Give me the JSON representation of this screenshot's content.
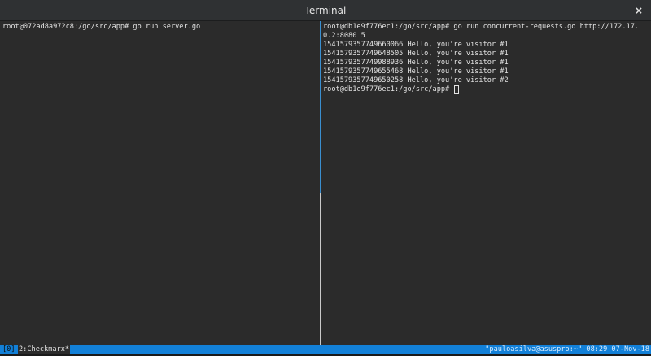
{
  "window": {
    "title": "Terminal",
    "close_glyph": "×"
  },
  "left_pane": {
    "lines": [
      "root@072ad8a972c8:/go/src/app# go run server.go"
    ]
  },
  "right_pane": {
    "lines": [
      "root@db1e9f776ec1:/go/src/app# go run concurrent-requests.go http://172.17.",
      "0.2:8080 5",
      "1541579357749660066 Hello, you're visitor #1",
      "1541579357749648505 Hello, you're visitor #1",
      "1541579357749988936 Hello, you're visitor #1",
      "1541579357749655468 Hello, you're visitor #1",
      "1541579357749650258 Hello, you're visitor #2"
    ],
    "prompt": "root@db1e9f776ec1:/go/src/app# "
  },
  "status_bar": {
    "session": "[0]",
    "window_tab": "2:Checkmarx*",
    "right": "\"pauloasilva@asuspro:~\" 08:29 07-Nov-18"
  }
}
